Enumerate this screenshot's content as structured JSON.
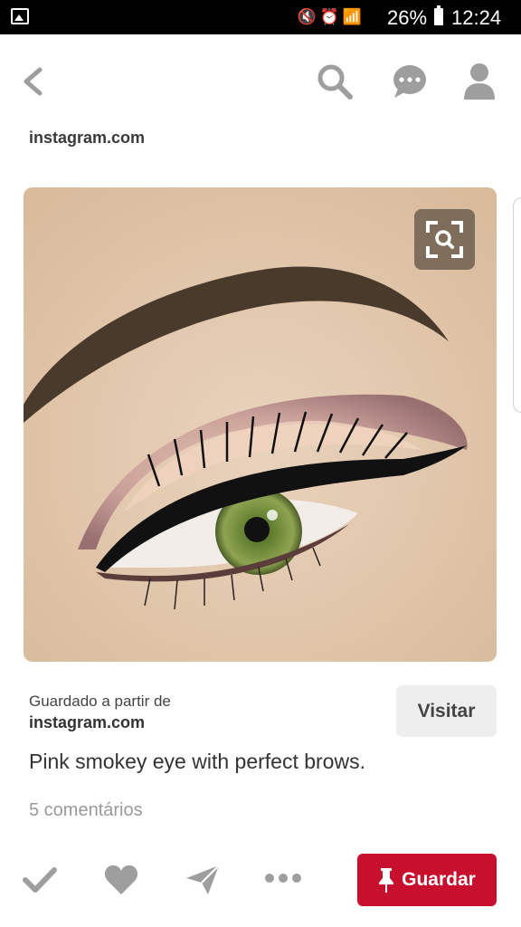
{
  "status_bar": {
    "battery": "26%",
    "time": "12:24",
    "icons": [
      "gallery-icon",
      "mute-icon",
      "alarm-icon",
      "wifi-icon",
      "signal-icon",
      "battery-icon"
    ]
  },
  "header": {
    "source": "instagram.com"
  },
  "pin": {
    "saved_from_label": "Guardado a partir de",
    "saved_from_domain": "instagram.com",
    "visit_label": "Visitar",
    "description": "Pink smokey eye with perfect brows.",
    "comments": "5 comentários"
  },
  "actions": {
    "save_label": "Guardar"
  },
  "colors": {
    "save_red": "#c8102e",
    "visit_bg": "#eeeeee",
    "icon_gray": "#9e9e9e"
  }
}
